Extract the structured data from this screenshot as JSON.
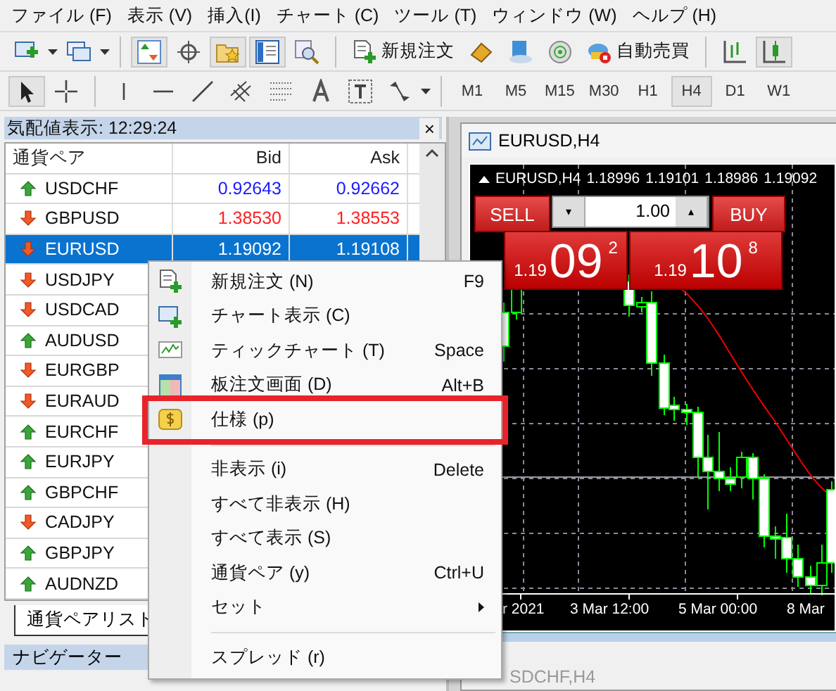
{
  "menu_bar": [
    "ファイル (F)",
    "表示 (V)",
    "挿入(I)",
    "チャート (C)",
    "ツール (T)",
    "ウィンドウ (W)",
    "ヘルプ (H)"
  ],
  "standard_toolbar": [
    {
      "kind": "new-chart",
      "selected": false
    },
    {
      "kind": "profiles",
      "selected": false
    },
    {
      "kind": "market-watch",
      "selected": true
    },
    {
      "kind": "data-window",
      "selected": false
    },
    {
      "kind": "navigator",
      "selected": true
    },
    {
      "kind": "terminal",
      "selected": true
    },
    {
      "kind": "tester",
      "selected": false
    },
    {
      "kind": "new-order",
      "label": "新規注文",
      "selected": false
    },
    {
      "kind": "editor",
      "selected": false
    },
    {
      "kind": "community",
      "selected": false
    },
    {
      "kind": "signals",
      "selected": false
    },
    {
      "kind": "auto-trading",
      "label": "自動売買",
      "selected": false
    },
    {
      "kind": "bar-chart",
      "selected": false
    },
    {
      "kind": "candle-chart",
      "selected": true
    }
  ],
  "drawing_toolbar": [
    {
      "kind": "pointer",
      "selected": true
    },
    {
      "kind": "crosshair",
      "selected": false
    },
    {
      "kind": "vline",
      "selected": false
    },
    {
      "kind": "hline",
      "selected": false
    },
    {
      "kind": "trendline",
      "selected": false
    },
    {
      "kind": "channel",
      "selected": false
    },
    {
      "kind": "fibo",
      "selected": false
    },
    {
      "kind": "text",
      "selected": false
    },
    {
      "kind": "label",
      "selected": false
    },
    {
      "kind": "arrows",
      "selected": false
    }
  ],
  "timeframes": [
    {
      "label": "M1",
      "selected": false
    },
    {
      "label": "M5",
      "selected": false
    },
    {
      "label": "M15",
      "selected": false
    },
    {
      "label": "M30",
      "selected": false
    },
    {
      "label": "H1",
      "selected": false
    },
    {
      "label": "H4",
      "selected": true
    },
    {
      "label": "D1",
      "selected": false
    },
    {
      "label": "W1",
      "selected": false
    }
  ],
  "market_watch": {
    "title": "気配値表示: 12:29:24",
    "close": "×",
    "columns": [
      "通貨ペア",
      "Bid",
      "Ask"
    ],
    "rows": [
      {
        "symbol": "USDCHF",
        "rising": true,
        "price_up": true,
        "bid": "0.92643",
        "ask": "0.92662",
        "selected": false
      },
      {
        "symbol": "GBPUSD",
        "rising": false,
        "price_up": false,
        "bid": "1.38530",
        "ask": "1.38553",
        "selected": false
      },
      {
        "symbol": "EURUSD",
        "rising": false,
        "bid": "1.19092",
        "ask": "1.19108",
        "selected": true
      },
      {
        "symbol": "USDJPY",
        "rising": false,
        "selected": false
      },
      {
        "symbol": "USDCAD",
        "rising": false,
        "selected": false
      },
      {
        "symbol": "AUDUSD",
        "rising": true,
        "selected": false
      },
      {
        "symbol": "EURGBP",
        "rising": false,
        "selected": false
      },
      {
        "symbol": "EURAUD",
        "rising": false,
        "selected": false
      },
      {
        "symbol": "EURCHF",
        "rising": true,
        "selected": false
      },
      {
        "symbol": "EURJPY",
        "rising": true,
        "selected": false
      },
      {
        "symbol": "GBPCHF",
        "rising": true,
        "selected": false
      },
      {
        "symbol": "CADJPY",
        "rising": false,
        "selected": false
      },
      {
        "symbol": "GBPJPY",
        "rising": true,
        "selected": false
      },
      {
        "symbol": "AUDNZD",
        "rising": true,
        "selected": false
      }
    ],
    "tabs": [
      {
        "label": "通貨ペアリスト",
        "selected": true
      }
    ]
  },
  "navigator": {
    "title": "ナビゲーター"
  },
  "chart_window": {
    "title": "EURUSD,H4",
    "info_symbol": "EURUSD,H4",
    "ohlc": [
      "1.18996",
      "1.19101",
      "1.18986",
      "1.19092"
    ],
    "trade_panel": {
      "sell_label": "SELL",
      "buy_label": "BUY",
      "lot": "1.00",
      "lot_down": "▾",
      "lot_up": "▴",
      "sell_price": {
        "prefix": "1.19",
        "big": "09",
        "small": "2"
      },
      "buy_price": {
        "prefix": "1.19",
        "big": "10",
        "small": "8"
      }
    },
    "time_axis": [
      "r 2021",
      "3 Mar 12:00",
      "5 Mar 00:00",
      "8 Mar"
    ]
  },
  "bottom_tab": {
    "label": "SDCHF,H4"
  },
  "context_menu": [
    {
      "kind": "item",
      "label": "新規注文 (N)",
      "shortcut": "F9"
    },
    {
      "kind": "item",
      "label": "チャート表示 (C)"
    },
    {
      "kind": "item",
      "label": "ティックチャート (T)",
      "shortcut": "Space"
    },
    {
      "kind": "item",
      "label": "板注文画面 (D)",
      "shortcut": "Alt+B"
    },
    {
      "kind": "item",
      "label": "仕様 (p)",
      "annotated": true
    },
    {
      "kind": "separator"
    },
    {
      "kind": "item",
      "label": "非表示 (i)",
      "shortcut": "Delete"
    },
    {
      "kind": "item",
      "label": "すべて非表示 (H)"
    },
    {
      "kind": "item",
      "label": "すべて表示 (S)"
    },
    {
      "kind": "item",
      "label": "通貨ペア (y)",
      "shortcut": "Ctrl+U"
    },
    {
      "kind": "submenu",
      "label": "セット"
    },
    {
      "kind": "separator"
    },
    {
      "kind": "item",
      "label": "スプレッド (r)"
    }
  ]
}
